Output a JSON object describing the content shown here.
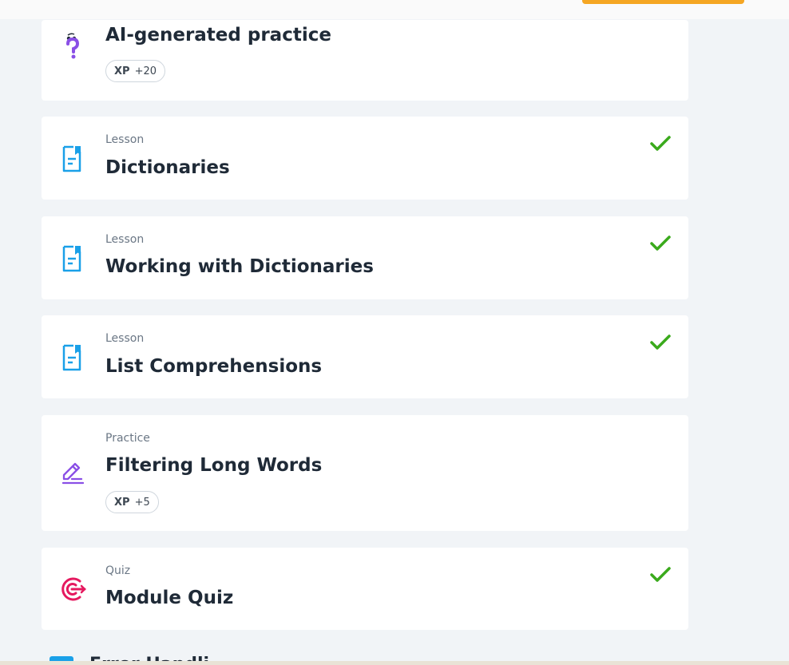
{
  "colors": {
    "accent_orange": "#f5a623",
    "check_green": "#3aaa1c",
    "lesson_blue": "#1aa0e8",
    "practice_purple": "#8a4fe6",
    "quiz_pink": "#e5195f"
  },
  "items": [
    {
      "kicker": "",
      "title": "AI-generated practice",
      "icon": "question-mark-icon",
      "xp_label": "XP",
      "xp_value": "+20",
      "completed": false
    },
    {
      "kicker": "Lesson",
      "title": "Dictionaries",
      "icon": "lesson-document-icon",
      "completed": true
    },
    {
      "kicker": "Lesson",
      "title": "Working with Dictionaries",
      "icon": "lesson-document-icon",
      "completed": true
    },
    {
      "kicker": "Lesson",
      "title": "List Comprehensions",
      "icon": "lesson-document-icon",
      "completed": true
    },
    {
      "kicker": "Practice",
      "title": "Filtering Long Words",
      "icon": "pencil-icon",
      "xp_label": "XP",
      "xp_value": "+5",
      "completed": false
    },
    {
      "kicker": "Quiz",
      "title": "Module Quiz",
      "icon": "target-icon",
      "completed": true
    }
  ],
  "next_section": {
    "title": "Error Handling"
  }
}
